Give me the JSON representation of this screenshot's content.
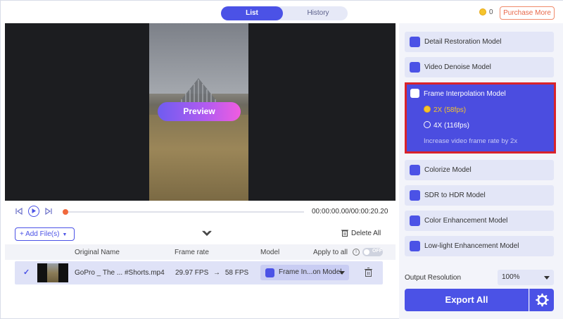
{
  "tabs": [
    {
      "label": "List",
      "active": true
    },
    {
      "label": "History",
      "active": false
    }
  ],
  "coins": "0",
  "purchase_label": "Purchase More",
  "preview_label": "Preview",
  "playback": {
    "time": "00:00:00.00/00:00:20.20",
    "progress": 0.0
  },
  "toolbar": {
    "add_files": "Add File(s)",
    "delete_all": "Delete All"
  },
  "table": {
    "headers": {
      "name": "Original Name",
      "frame_rate": "Frame rate",
      "model": "Model",
      "apply_all": "Apply to all"
    },
    "apply_all_toggle": "OFF",
    "rows": [
      {
        "name": "GoPro _ The ... #Shorts.mp4",
        "fps_from": "29.97 FPS",
        "fps_to": "58 FPS",
        "model": "Frame In...on Model"
      }
    ]
  },
  "models": [
    {
      "label": "Detail Restoration Model",
      "icon": "detail-restoration-icon"
    },
    {
      "label": "Video Denoise Model",
      "icon": "video-denoise-icon"
    },
    {
      "label": "Frame Interpolation Model",
      "icon": "frame-interpolation-icon",
      "expanded": true,
      "options": [
        {
          "label": "2X (58fps)",
          "selected": true
        },
        {
          "label": "4X (116fps)",
          "selected": false
        }
      ],
      "description": "Increase video frame rate by 2x"
    },
    {
      "label": "Colorize Model",
      "icon": "colorize-icon"
    },
    {
      "label": "SDR to HDR Model",
      "icon": "hdr-icon"
    },
    {
      "label": "Color Enhancement Model",
      "icon": "palette-icon"
    },
    {
      "label": "Low-light Enhancement Model",
      "icon": "moon-icon"
    }
  ],
  "output": {
    "label": "Output Resolution",
    "value": "100%"
  },
  "export_label": "Export All",
  "colors": {
    "accent": "#4b52e6",
    "highlight_border": "#d9232b",
    "selected_option": "#f5c42c"
  }
}
